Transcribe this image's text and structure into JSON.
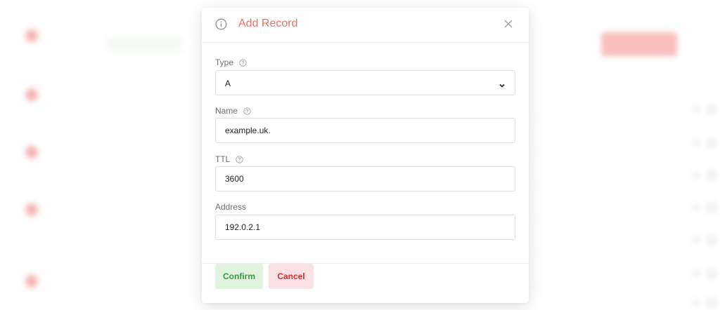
{
  "dialog": {
    "title": "Add Record",
    "close_icon": "close-icon",
    "info_icon": "info-circle-icon"
  },
  "form": {
    "type": {
      "label": "Type",
      "value": "A",
      "help_icon": "help-circle-icon"
    },
    "name": {
      "label": "Name",
      "value": "example.uk.",
      "help_icon": "help-circle-icon"
    },
    "ttl": {
      "label": "TTL",
      "value": "3600",
      "help_icon": "help-circle-icon"
    },
    "address": {
      "label": "Address",
      "value": "192.0.2.1"
    }
  },
  "buttons": {
    "confirm": "Confirm",
    "cancel": "Cancel"
  },
  "colors": {
    "title": "#f07164",
    "confirm_bg": "#dff3df",
    "confirm_text": "#3a9a3e",
    "cancel_bg": "#fbe1e3",
    "cancel_text": "#d32f3a"
  }
}
